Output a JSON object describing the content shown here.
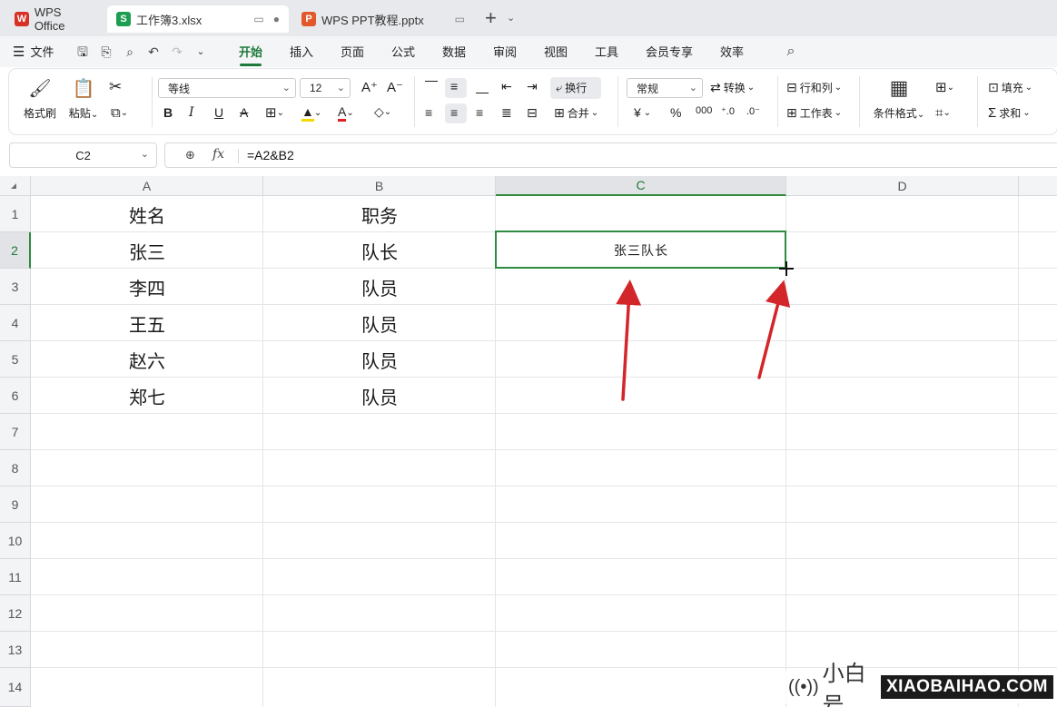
{
  "tabs": [
    {
      "label": "WPS Office",
      "logo": "W",
      "logo_color": "#d93025"
    },
    {
      "label": "工作簿3.xlsx",
      "logo": "S",
      "logo_color": "#1e9e52"
    },
    {
      "label": "WPS PPT教程.pptx",
      "logo": "P",
      "logo_color": "#e2582b"
    }
  ],
  "menu": {
    "file_label": "文件",
    "tabs": [
      "开始",
      "插入",
      "页面",
      "公式",
      "数据",
      "审阅",
      "视图",
      "工具",
      "会员专享",
      "效率"
    ],
    "active_tab": "开始"
  },
  "ribbon": {
    "format_painter": "格式刷",
    "paste": "粘贴",
    "font_name": "等线",
    "font_size": "12",
    "wrap_text": "换行",
    "merge": "合并",
    "number_format": "常规",
    "convert": "转换",
    "rows_cols": "行和列",
    "worksheet": "工作表",
    "conditional_format": "条件格式",
    "fill": "填充",
    "sum": "求和"
  },
  "formula_bar": {
    "name_box": "C2",
    "fx": "fx",
    "formula": "=A2&B2"
  },
  "grid": {
    "columns": [
      "A",
      "B",
      "C",
      "D"
    ],
    "selected_column": "C",
    "rows": [
      "1",
      "2",
      "3",
      "4",
      "5",
      "6",
      "7",
      "8",
      "9",
      "10",
      "11",
      "12",
      "13",
      "14"
    ],
    "selected_row": "2",
    "cells": {
      "A1": "姓名",
      "B1": "职务",
      "A2": "张三",
      "B2": "队长",
      "C2": "张三队长",
      "A3": "李四",
      "B3": "队员",
      "A4": "王五",
      "B4": "队员",
      "A5": "赵六",
      "B5": "队员",
      "A6": "郑七",
      "B6": "队员"
    }
  },
  "watermark": {
    "chinese": "小白号",
    "domain": "XIAOBAIHAO.COM"
  },
  "colors": {
    "accent_green": "#2e8b3f",
    "arrow_red": "#d3262a"
  }
}
